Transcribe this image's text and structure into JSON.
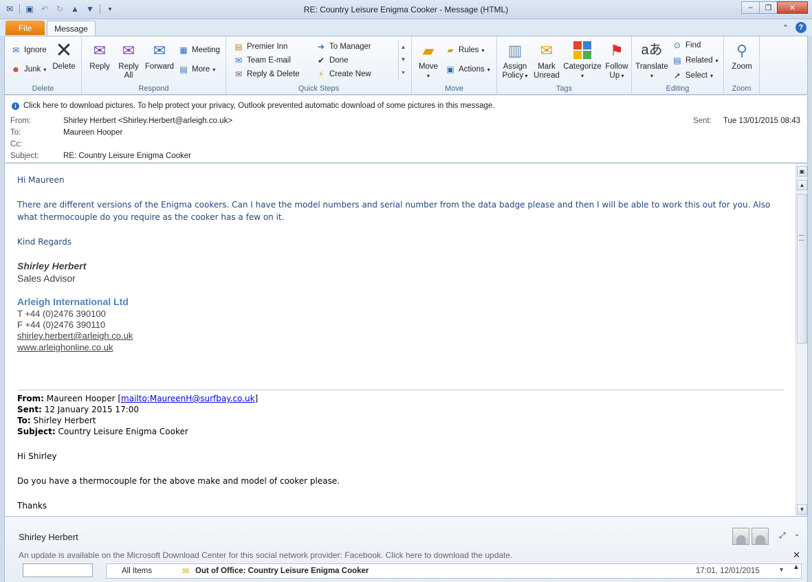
{
  "window": {
    "title": "RE: Country Leisure Enigma Cooker  -  Message (HTML)"
  },
  "tabs": {
    "file": "File",
    "message": "Message"
  },
  "ribbon": {
    "delete_group": {
      "ignore": "Ignore",
      "junk": "Junk",
      "delete": "Delete",
      "label": "Delete"
    },
    "respond_group": {
      "reply": "Reply",
      "reply_all_line1": "Reply",
      "reply_all_line2": "All",
      "forward": "Forward",
      "meeting": "Meeting",
      "more": "More",
      "label": "Respond"
    },
    "quick_steps": {
      "premier_inn": "Premier Inn",
      "team_email": "Team E-mail",
      "reply_delete": "Reply & Delete",
      "to_manager": "To Manager",
      "done": "Done",
      "create_new": "Create New",
      "label": "Quick Steps"
    },
    "move_group": {
      "move": "Move",
      "rules": "Rules",
      "actions": "Actions",
      "label": "Move"
    },
    "tags_group": {
      "assign_policy_line1": "Assign",
      "assign_policy_line2": "Policy",
      "mark_unread_line1": "Mark",
      "mark_unread_line2": "Unread",
      "categorize": "Categorize",
      "follow_up_line1": "Follow",
      "follow_up_line2": "Up",
      "label": "Tags"
    },
    "editing_group": {
      "translate": "Translate",
      "find": "Find",
      "related": "Related",
      "select": "Select",
      "label": "Editing"
    },
    "zoom_group": {
      "zoom": "Zoom",
      "label": "Zoom"
    }
  },
  "infobar": "Click here to download pictures. To help protect your privacy, Outlook prevented automatic download of some pictures in this message.",
  "header": {
    "from_label": "From:",
    "from_value": "Shirley Herbert <Shirley.Herbert@arleigh.co.uk>",
    "to_label": "To:",
    "to_value": "Maureen Hooper",
    "cc_label": "Cc:",
    "cc_value": "",
    "subject_label": "Subject:",
    "subject_value": "RE: Country Leisure Enigma Cooker",
    "sent_label": "Sent:",
    "sent_value": "Tue 13/01/2015 08:43"
  },
  "body": {
    "greeting": "Hi Maureen",
    "para1_line1": "There are different versions of the Enigma cookers.  Can I have the model numbers and serial number from the data badge please and then I will be able to work this out for you.  Also",
    "para1_line2": "what thermocouple do you require as the cooker has a few on it.",
    "closing": "Kind Regards",
    "sig_name": "Shirley Herbert",
    "sig_title": "Sales Advisor",
    "sig_company": "Arleigh International Ltd",
    "sig_tel": "T +44 (0)2476 390100",
    "sig_fax": "F +44 (0)2476 390110",
    "sig_email": "shirley.herbert@arleigh.co.uk",
    "sig_web": "www.arleighonline.co.uk",
    "quoted": {
      "from_label": "From:",
      "from_value": "Maureen Hooper",
      "from_link": "mailto:MaureenH@surfbay.co.uk",
      "sent_label": "Sent:",
      "sent_value": "12 January 2015 17:00",
      "to_label": "To:",
      "to_value": "Shirley Herbert",
      "subject_label": "Subject:",
      "subject_value": "Country Leisure Enigma Cooker",
      "greeting": "Hi Shirley",
      "line1": "Do you have a thermocouple for the above make and  model of cooker please.",
      "thanks": "Thanks"
    }
  },
  "people_pane": {
    "name": "Shirley Herbert",
    "update_notice": "An update is available on the Microsoft Download Center for this social network provider: Facebook. Click here to download the update.",
    "all_items": "All Items",
    "item_subject": "Out of Office: Country Leisure Enigma Cooker",
    "item_date": "17:01, 12/01/2015"
  }
}
